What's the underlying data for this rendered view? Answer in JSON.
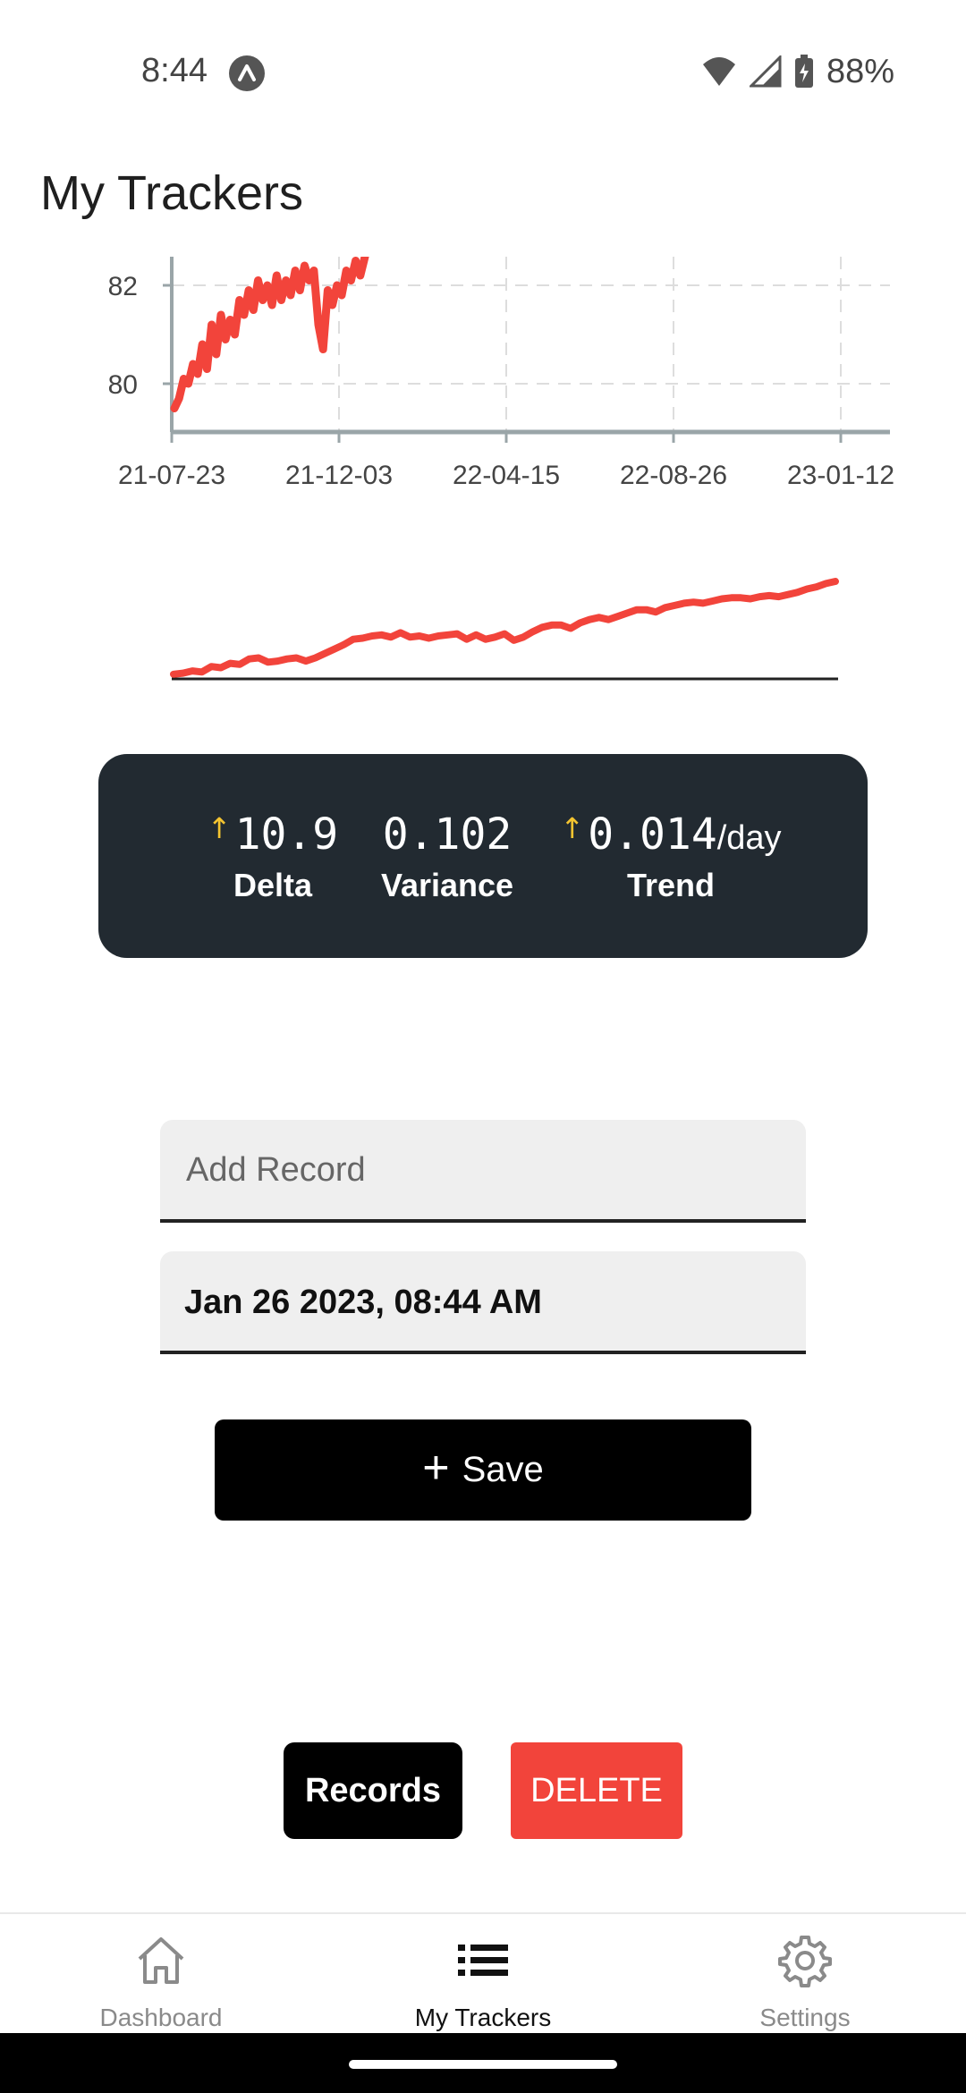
{
  "status_bar": {
    "time": "8:44",
    "battery": "88%"
  },
  "header": {
    "title": "My Trackers"
  },
  "chart_data": {
    "type": "line",
    "y_ticks": [
      "82",
      "80"
    ],
    "x_ticks": [
      "21-07-23",
      "21-12-03",
      "22-04-15",
      "22-08-26",
      "23-01-12"
    ],
    "series": [
      {
        "color": "#f2443b",
        "values": [
          79.5,
          79.7,
          80.1,
          80.0,
          80.4,
          80.2,
          80.8,
          80.3,
          81.2,
          80.6,
          81.4,
          80.9,
          81.3,
          81.0,
          81.7,
          81.4,
          81.9,
          81.5,
          82.1,
          81.7,
          82.0,
          81.6,
          82.2,
          81.7,
          82.1,
          81.8,
          82.3,
          81.9,
          82.4,
          82.1,
          82.3,
          81.2,
          80.7,
          81.9,
          81.6,
          82.0,
          81.8,
          82.3,
          82.1,
          82.5,
          82.2,
          82.6
        ]
      }
    ],
    "grid": true,
    "color": "#f2443b"
  },
  "sparkline": {
    "color": "#f2443b",
    "values": [
      1,
      2,
      4,
      3,
      8,
      7,
      11,
      10,
      15,
      16,
      12,
      13,
      15,
      16,
      13,
      16,
      20,
      24,
      28,
      33,
      34,
      36,
      37,
      35,
      39,
      35,
      36,
      34,
      36,
      37,
      38,
      33,
      37,
      33,
      35,
      38,
      32,
      35,
      40,
      44,
      46,
      46,
      43,
      48,
      51,
      53,
      51,
      54,
      57,
      60,
      60,
      58,
      62,
      64,
      66,
      67,
      66,
      68,
      70,
      71,
      71,
      70,
      72,
      73,
      72,
      74,
      76,
      79,
      81,
      84,
      86
    ]
  },
  "stats": {
    "delta_value": "10.9",
    "delta_label": "Delta",
    "variance_value": "0.102",
    "variance_label": "Variance",
    "trend_value": "0.014",
    "trend_unit": "/day",
    "trend_label": "Trend",
    "arrow_color": "#f4c430"
  },
  "form": {
    "record_placeholder": "Add Record",
    "date_value": "Jan 26 2023, 08:44 AM",
    "save_label": "Save"
  },
  "actions": {
    "records_label": "Records",
    "delete_label": "DELETE",
    "delete_color": "#f2443b"
  },
  "nav": {
    "dashboard": "Dashboard",
    "my_trackers": "My Trackers",
    "settings": "Settings"
  }
}
